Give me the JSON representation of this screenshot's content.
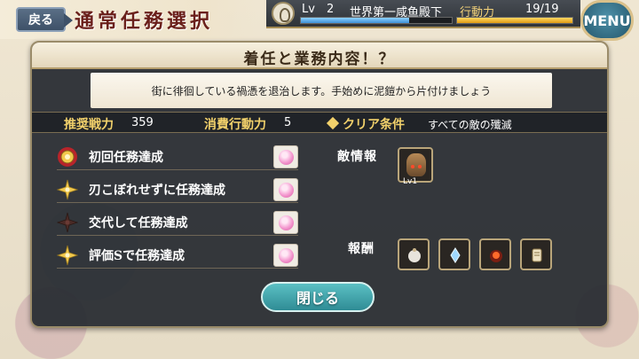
{
  "header": {
    "back_label": "戻る",
    "title": "通常任務選択",
    "level_label": "Lv",
    "level_value": "2",
    "player_name": "世界第一咸鱼殿下",
    "stamina_label": "行動力",
    "stamina_value": "19/19",
    "exp_progress": 0.72,
    "stamina_progress": 1.0,
    "menu_label": "MENU"
  },
  "dialog": {
    "title": "着任と業務内容！？",
    "description": "街に徘徊している禍憑を退治します。手始めに泥鎧から片付けましょう",
    "stats": {
      "power_label": "推奨戦力",
      "power_value": "359",
      "cost_label": "消費行動力",
      "cost_value": "5",
      "clear_label": "クリア条件",
      "clear_value": "すべての敵の殲滅"
    },
    "achievements": [
      {
        "label": "初回任務達成",
        "icon": "gold-medal-icon"
      },
      {
        "label": "刃こぼれせずに任務達成",
        "icon": "gold-star-icon"
      },
      {
        "label": "交代して任務達成",
        "icon": "dark-star-icon"
      },
      {
        "label": "評価Sで任務達成",
        "icon": "gold-star-icon"
      }
    ],
    "enemy_label": "敵情報",
    "enemy_level": "Lv1",
    "rewards_label": "報酬",
    "rewards": [
      "pouch-icon",
      "blade-shard-icon",
      "fire-orb-icon",
      "scroll-icon"
    ],
    "close_label": "閉じる"
  },
  "colors": {
    "accent_gold": "#f2d16b",
    "title_red": "#6a1f1a",
    "close_teal": "#2f8c95"
  }
}
